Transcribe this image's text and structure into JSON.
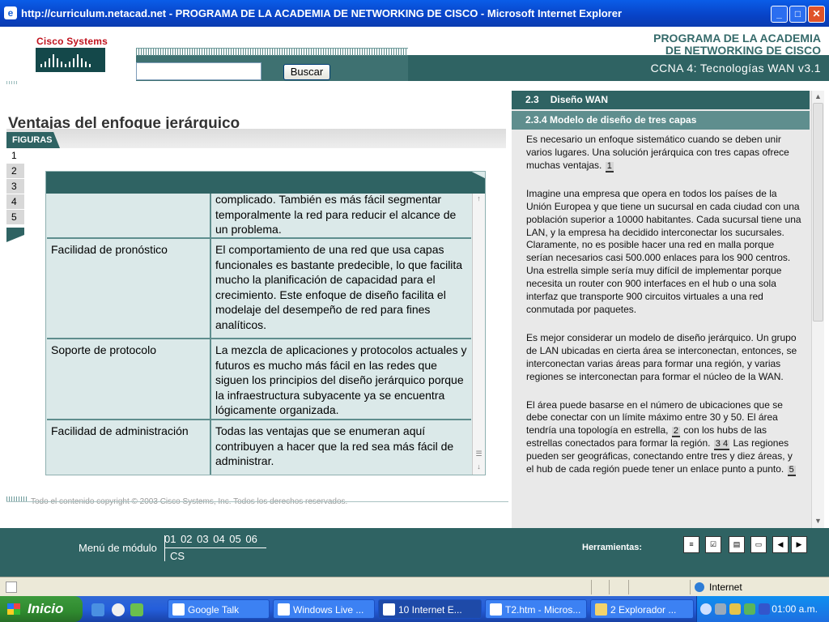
{
  "window": {
    "title": "http://curriculum.netacad.net - PROGRAMA DE LA ACADEMIA DE NETWORKING DE CISCO - Microsoft Internet Explorer",
    "btn_minimize": "_",
    "btn_maximize": "□",
    "btn_close": "✕"
  },
  "header": {
    "logo_text": "Cisco Systems",
    "search_placeholder": "",
    "search_button": "Buscar",
    "program_title_line1": "PROGRAMA DE LA ACADEMIA",
    "program_title_line2": "DE NETWORKING DE CISCO",
    "course": "CCNA 4: Tecnologías WAN v3.1"
  },
  "main": {
    "section_title": "Ventajas del enfoque jerárquico",
    "figures_tab": "FIGURAS",
    "figure_numbers": [
      "1",
      "2",
      "3",
      "4",
      "5"
    ],
    "active_figure": "1",
    "table_rows": [
      {
        "label": "",
        "text": "complicado.  También es más fácil segmentar temporalmente la red para reducir el alcance de un problema."
      },
      {
        "label": "Facilidad de pronóstico",
        "text": "El comportamiento de una red que usa capas funcionales es bastante predecible, lo que facilita mucho la planificación de capacidad para el crecimiento. Este enfoque de diseño facilita el modelaje del desempeño de red para fines analíticos."
      },
      {
        "label": " Soporte de protocolo",
        "text": "La mezcla de aplicaciones y protocolos actuales y futuros es mucho más fácil en las redes que siguen los principios del diseño jerárquico porque la infraestructura subyacente ya se encuentra lógicamente organizada."
      },
      {
        "label": "Facilidad de administración",
        "text": "Todas las ventajas que se enumeran aquí contribuyen a hacer que la red sea más fácil de administrar."
      }
    ],
    "copyright": "Todo el contenido copyright © 2003 Cisco Systems, Inc. Todos los derechos reservados."
  },
  "sidebar": {
    "section_number": "2.3",
    "section_name": "Diseño WAN",
    "subsection": "2.3.4 Modelo de diseño de tres capas",
    "p1": "Es necesario un enfoque sistemático cuando se deben unir varios lugares. Una solución jerárquica con tres capas ofrece muchas ventajas.",
    "p1_ref": "1",
    "p2": "Imagine una empresa que opera en todos los países de la Unión Europea y que tiene un sucursal en cada ciudad con una población superior a 10000 habitantes. Cada sucursal tiene una LAN, y la empresa ha decidido interconectar los sucursales. Claramente, no es posible hacer una red en malla porque serían necesarios casi 500.000 enlaces para los 900 centros. Una estrella simple sería muy difícil de implementar porque necesita un router con 900 interfaces en el hub o una sola interfaz que transporte 900 circuitos virtuales a una red conmutada por paquetes.",
    "p3": "Es mejor considerar un modelo de diseño jerárquico. Un grupo de LAN ubicadas en cierta área se interconectan, entonces, se interconectan varias áreas para formar una región, y varias regiones se interconectan para formar el núcleo de la WAN.",
    "p4_a": "El área puede basarse en el número de ubicaciones que se debe conectar con un límite máximo entre 30 y 50. El área tendría una topología en estrella,",
    "p4_ref1": "2",
    "p4_b": "con los hubs de las estrellas conectados para formar la región.",
    "p4_ref2": "3 4",
    "p4_c": "Las regiones pueden ser geográficas, conectando entre tres y diez áreas, y el hub de cada región puede tener un enlace punto a punto.",
    "p4_ref3": "5"
  },
  "footer": {
    "module_menu_label": "Menú de módulo",
    "modules": "01 02 03 04 05 06",
    "cs": "CS",
    "tools_label": "Herramientas:"
  },
  "statusbar": {
    "zone": "Internet"
  },
  "taskbar": {
    "start": "Inicio",
    "tasks": [
      {
        "label": "Google Talk"
      },
      {
        "label": "Windows Live ..."
      },
      {
        "label": "10 Internet E..."
      },
      {
        "label": "T2.htm - Micros..."
      },
      {
        "label": "2 Explorador ..."
      }
    ],
    "clock": "01:00 a.m."
  }
}
